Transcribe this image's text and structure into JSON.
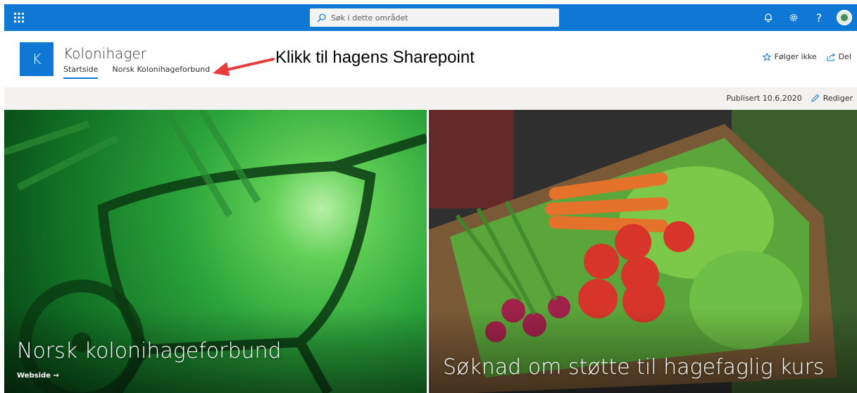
{
  "suite": {
    "search_placeholder": "Søk i dette området",
    "icons": [
      "app-launcher-icon",
      "search-icon",
      "bell-icon",
      "gear-icon",
      "help-icon",
      "avatar"
    ],
    "help_label": "?"
  },
  "site": {
    "logo_letter": "K",
    "title": "Kolonihager",
    "nav": [
      {
        "label": "Startside",
        "active": true
      },
      {
        "label": "Norsk Kolonihageforbund",
        "active": false
      }
    ],
    "annotation": "Klikk til hagens Sharepoint",
    "actions": {
      "follow_label": "Følger ikke",
      "share_label": "Del"
    }
  },
  "command_bar": {
    "published": "Publisert 10.6.2020",
    "edit_label": "Rediger"
  },
  "hero": {
    "tiles": [
      {
        "title": "Norsk kolonihageforbund",
        "link": "Webside →"
      },
      {
        "title": "Søknad om støtte til hagefaglig kurs"
      }
    ]
  },
  "colors": {
    "brand": "#0f78d4",
    "annotation_arrow": "#e83b3b",
    "command_bar": "#f3f2f1"
  }
}
